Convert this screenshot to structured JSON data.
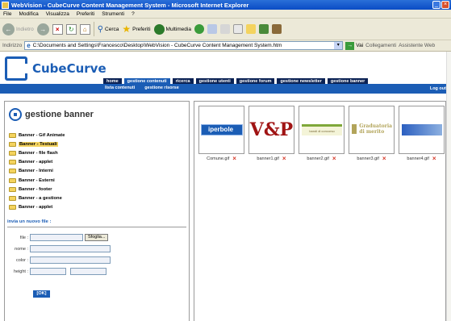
{
  "window": {
    "title": "WebVision - CubeCurve Content Management System - Microsoft Internet Explorer",
    "buttons": [
      "_",
      "□",
      "×"
    ]
  },
  "menu": {
    "items": [
      "File",
      "Modifica",
      "Visualizza",
      "Preferiti",
      "Strumenti",
      "?"
    ]
  },
  "toolbar": {
    "back_label": "Indietro",
    "search_label": "Cerca",
    "favorites_label": "Preferiti",
    "multimedia_label": "Multimedia"
  },
  "address": {
    "label": "Indirizzo",
    "url": "C:\\Documents and Settings\\Francesco\\Desktop\\WebVision - CubeCurve Content Management System.htm",
    "go_label": "Vai",
    "links_label": "Collegamenti",
    "assistant_label": "Assistente Web"
  },
  "site": {
    "brand": "CubeCurve",
    "nav": [
      "home",
      "gestione contenuti",
      "ricerca",
      "gestione utenti",
      "gestione forum",
      "gestione newsletter",
      "gestione banner"
    ],
    "subnav": [
      "lista contenuti",
      "gestione risorse"
    ],
    "logout": "Log out"
  },
  "left": {
    "title": "gestione banner",
    "folders": [
      {
        "label": "Banner - Gif Animate",
        "active": false
      },
      {
        "label": "Banner - Testuali",
        "active": true
      },
      {
        "label": "Banner - file flash",
        "active": false
      },
      {
        "label": "Banner - applet",
        "active": false
      },
      {
        "label": "Banner - Interni",
        "active": false
      },
      {
        "label": "Banner - Esterni",
        "active": false
      },
      {
        "label": "Banner - footer",
        "active": false
      },
      {
        "label": "Banner - a gestione",
        "active": false
      },
      {
        "label": "Banner - applet",
        "active": false
      }
    ],
    "upload_title": "invia un nuovo file :",
    "form": {
      "file_label": "file :",
      "browse_label": "Sfoglia...",
      "name_label": "nome :",
      "color_label": "color :",
      "height_label": "height :",
      "ok_label": "[OK]"
    }
  },
  "right": {
    "thumbs": [
      {
        "file": "Comune.gif",
        "caption": "iperbole"
      },
      {
        "file": "banner1.gif",
        "caption": "V&P"
      },
      {
        "file": "banner2.gif",
        "caption": "bandi di concorso"
      },
      {
        "file": "banner3.gif",
        "caption": "Graduatoria di merito"
      },
      {
        "file": "banner4.gif",
        "caption": ""
      }
    ],
    "delete_icon": "×"
  }
}
